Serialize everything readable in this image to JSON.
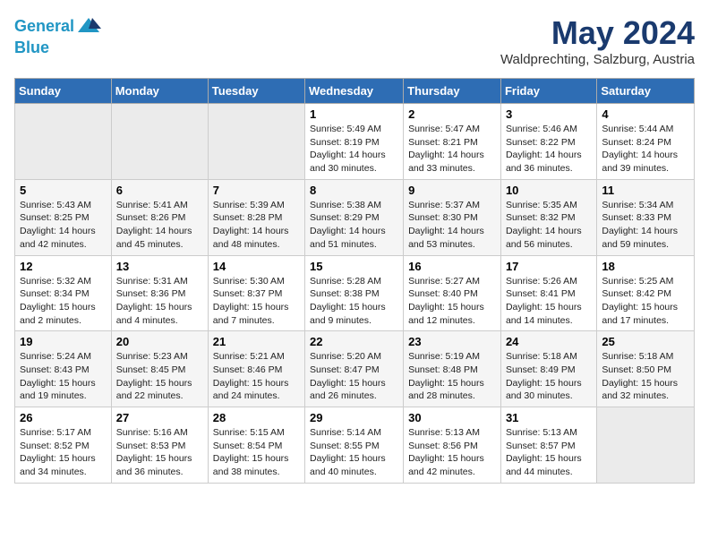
{
  "header": {
    "logo_line1": "General",
    "logo_line2": "Blue",
    "month": "May 2024",
    "location": "Waldprechting, Salzburg, Austria"
  },
  "weekdays": [
    "Sunday",
    "Monday",
    "Tuesday",
    "Wednesday",
    "Thursday",
    "Friday",
    "Saturday"
  ],
  "weeks": [
    [
      {
        "day": "",
        "empty": true
      },
      {
        "day": "",
        "empty": true
      },
      {
        "day": "",
        "empty": true
      },
      {
        "day": "1",
        "sunrise": "5:49 AM",
        "sunset": "8:19 PM",
        "daylight": "14 hours and 30 minutes."
      },
      {
        "day": "2",
        "sunrise": "5:47 AM",
        "sunset": "8:21 PM",
        "daylight": "14 hours and 33 minutes."
      },
      {
        "day": "3",
        "sunrise": "5:46 AM",
        "sunset": "8:22 PM",
        "daylight": "14 hours and 36 minutes."
      },
      {
        "day": "4",
        "sunrise": "5:44 AM",
        "sunset": "8:24 PM",
        "daylight": "14 hours and 39 minutes."
      }
    ],
    [
      {
        "day": "5",
        "sunrise": "5:43 AM",
        "sunset": "8:25 PM",
        "daylight": "14 hours and 42 minutes."
      },
      {
        "day": "6",
        "sunrise": "5:41 AM",
        "sunset": "8:26 PM",
        "daylight": "14 hours and 45 minutes."
      },
      {
        "day": "7",
        "sunrise": "5:39 AM",
        "sunset": "8:28 PM",
        "daylight": "14 hours and 48 minutes."
      },
      {
        "day": "8",
        "sunrise": "5:38 AM",
        "sunset": "8:29 PM",
        "daylight": "14 hours and 51 minutes."
      },
      {
        "day": "9",
        "sunrise": "5:37 AM",
        "sunset": "8:30 PM",
        "daylight": "14 hours and 53 minutes."
      },
      {
        "day": "10",
        "sunrise": "5:35 AM",
        "sunset": "8:32 PM",
        "daylight": "14 hours and 56 minutes."
      },
      {
        "day": "11",
        "sunrise": "5:34 AM",
        "sunset": "8:33 PM",
        "daylight": "14 hours and 59 minutes."
      }
    ],
    [
      {
        "day": "12",
        "sunrise": "5:32 AM",
        "sunset": "8:34 PM",
        "daylight": "15 hours and 2 minutes."
      },
      {
        "day": "13",
        "sunrise": "5:31 AM",
        "sunset": "8:36 PM",
        "daylight": "15 hours and 4 minutes."
      },
      {
        "day": "14",
        "sunrise": "5:30 AM",
        "sunset": "8:37 PM",
        "daylight": "15 hours and 7 minutes."
      },
      {
        "day": "15",
        "sunrise": "5:28 AM",
        "sunset": "8:38 PM",
        "daylight": "15 hours and 9 minutes."
      },
      {
        "day": "16",
        "sunrise": "5:27 AM",
        "sunset": "8:40 PM",
        "daylight": "15 hours and 12 minutes."
      },
      {
        "day": "17",
        "sunrise": "5:26 AM",
        "sunset": "8:41 PM",
        "daylight": "15 hours and 14 minutes."
      },
      {
        "day": "18",
        "sunrise": "5:25 AM",
        "sunset": "8:42 PM",
        "daylight": "15 hours and 17 minutes."
      }
    ],
    [
      {
        "day": "19",
        "sunrise": "5:24 AM",
        "sunset": "8:43 PM",
        "daylight": "15 hours and 19 minutes."
      },
      {
        "day": "20",
        "sunrise": "5:23 AM",
        "sunset": "8:45 PM",
        "daylight": "15 hours and 22 minutes."
      },
      {
        "day": "21",
        "sunrise": "5:21 AM",
        "sunset": "8:46 PM",
        "daylight": "15 hours and 24 minutes."
      },
      {
        "day": "22",
        "sunrise": "5:20 AM",
        "sunset": "8:47 PM",
        "daylight": "15 hours and 26 minutes."
      },
      {
        "day": "23",
        "sunrise": "5:19 AM",
        "sunset": "8:48 PM",
        "daylight": "15 hours and 28 minutes."
      },
      {
        "day": "24",
        "sunrise": "5:18 AM",
        "sunset": "8:49 PM",
        "daylight": "15 hours and 30 minutes."
      },
      {
        "day": "25",
        "sunrise": "5:18 AM",
        "sunset": "8:50 PM",
        "daylight": "15 hours and 32 minutes."
      }
    ],
    [
      {
        "day": "26",
        "sunrise": "5:17 AM",
        "sunset": "8:52 PM",
        "daylight": "15 hours and 34 minutes."
      },
      {
        "day": "27",
        "sunrise": "5:16 AM",
        "sunset": "8:53 PM",
        "daylight": "15 hours and 36 minutes."
      },
      {
        "day": "28",
        "sunrise": "5:15 AM",
        "sunset": "8:54 PM",
        "daylight": "15 hours and 38 minutes."
      },
      {
        "day": "29",
        "sunrise": "5:14 AM",
        "sunset": "8:55 PM",
        "daylight": "15 hours and 40 minutes."
      },
      {
        "day": "30",
        "sunrise": "5:13 AM",
        "sunset": "8:56 PM",
        "daylight": "15 hours and 42 minutes."
      },
      {
        "day": "31",
        "sunrise": "5:13 AM",
        "sunset": "8:57 PM",
        "daylight": "15 hours and 44 minutes."
      },
      {
        "day": "",
        "empty": true
      }
    ]
  ]
}
